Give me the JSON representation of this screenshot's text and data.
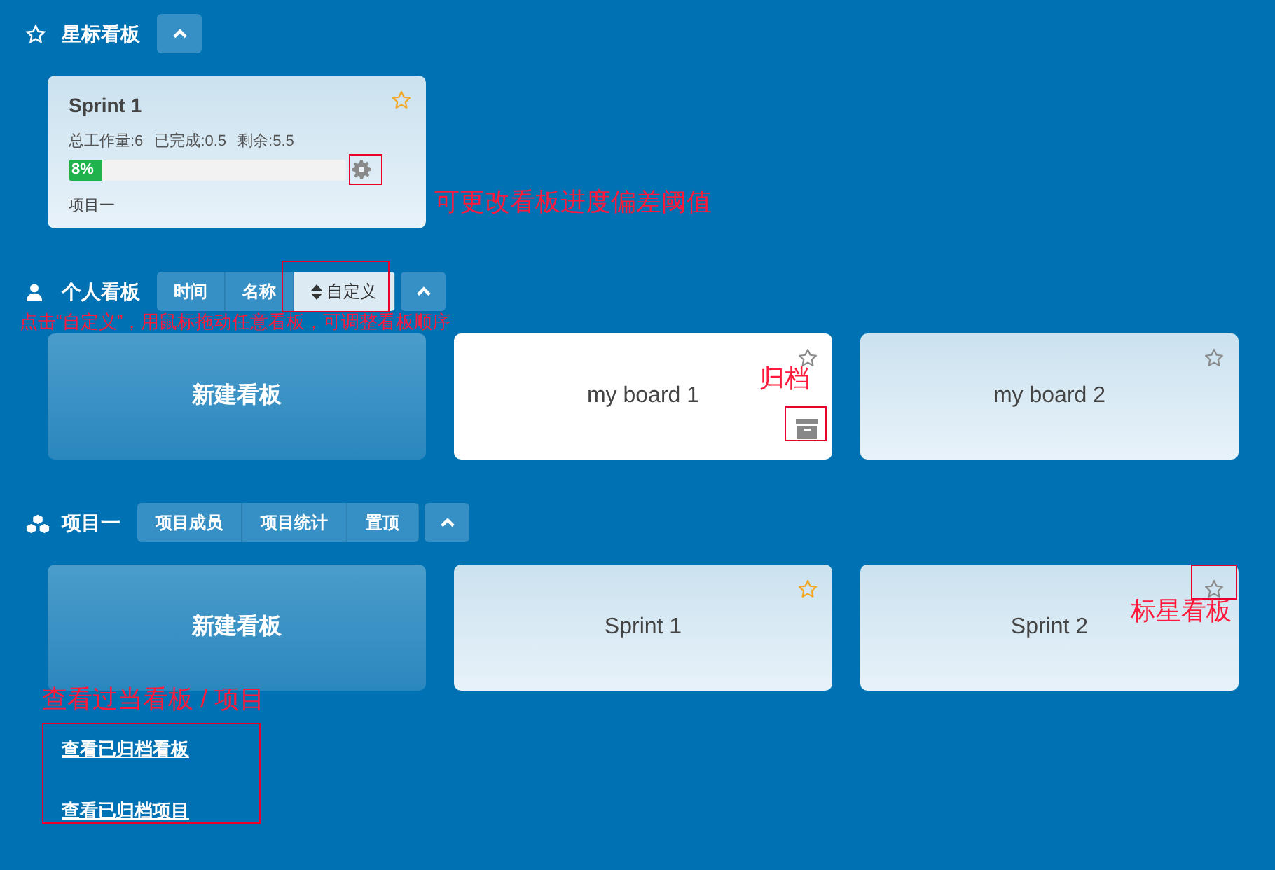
{
  "starred_section": {
    "title": "星标看板",
    "boards": [
      {
        "name": "Sprint 1",
        "starred": true,
        "stats": [
          "总工作量:6",
          "已完成:0.5",
          "剩余:5.5"
        ],
        "progress_label": "8%",
        "level": 0.08,
        "project": "项目一"
      }
    ]
  },
  "personal_section": {
    "title": "个人看板",
    "sort_tabs": [
      {
        "label": "时间",
        "selected": false
      },
      {
        "label": "名称",
        "selected": false
      },
      {
        "label": "自定义",
        "selected": true
      }
    ],
    "boards": [
      {
        "kind": "new",
        "name": "新建看板"
      },
      {
        "kind": "board",
        "name": "my board 1",
        "starred": false,
        "hovered": true
      },
      {
        "kind": "board",
        "name": "my board 2",
        "starred": false,
        "hovered": false
      }
    ]
  },
  "project_section": {
    "title": "项目一",
    "actions": [
      "项目成员",
      "项目统计",
      "置顶"
    ],
    "boards": [
      {
        "kind": "new",
        "name": "新建看板"
      },
      {
        "kind": "board",
        "name": "Sprint 1",
        "starred": true,
        "hovered": false
      },
      {
        "kind": "board",
        "name": "Sprint 2",
        "starred": false,
        "hovered": false
      }
    ]
  },
  "links": [
    "查看已归档看板",
    "查看已归档项目"
  ],
  "annotations": [
    {
      "kind": "gear",
      "text": "可更改看板进度偏差阈值"
    },
    {
      "kind": "sort",
      "text": "点击“自定义”，用鼠标拖动任意看板，可调整看板顺序"
    },
    {
      "kind": "archive",
      "text": "归档"
    },
    {
      "kind": "star",
      "text": "标星看板"
    },
    {
      "kind": "links",
      "text": "查看过当看板 / 项目"
    }
  ]
}
